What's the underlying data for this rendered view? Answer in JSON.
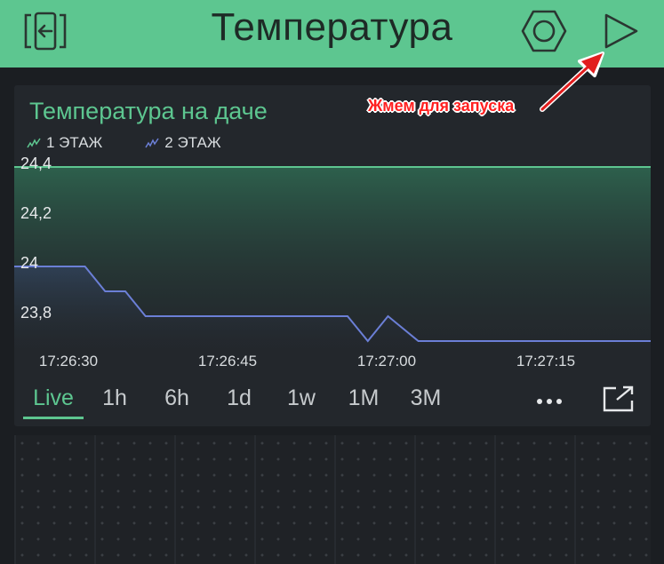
{
  "header": {
    "title": "Температура",
    "back_icon": "exit-app-icon",
    "settings_icon": "hexagon-settings-icon",
    "play_icon": "play-icon",
    "color": "#5dc690"
  },
  "card": {
    "title": "Температура на даче",
    "legend": [
      {
        "label": "1 ЭТАЖ",
        "color": "#5dc690"
      },
      {
        "label": "2 ЭТАЖ",
        "color": "#6b7fd6"
      }
    ],
    "time_ranges": [
      {
        "label": "Live",
        "active": true
      },
      {
        "label": "1h",
        "active": false
      },
      {
        "label": "6h",
        "active": false
      },
      {
        "label": "1d",
        "active": false
      },
      {
        "label": "1w",
        "active": false
      },
      {
        "label": "1M",
        "active": false
      },
      {
        "label": "3M",
        "active": false
      }
    ],
    "more_icon": "more-horizontal-icon",
    "expand_icon": "open-fullscreen-icon"
  },
  "annotation": {
    "text": "Жмем для запуска",
    "color": "#ff2020"
  },
  "chart_data": {
    "type": "line",
    "title": "Температура на даче",
    "y_tick_labels": [
      "24,4",
      "24,2",
      "24",
      "23,8"
    ],
    "x_tick_labels": [
      "17:26:30",
      "17:26:45",
      "17:27:00",
      "17:27:15"
    ],
    "ylim": [
      23.62,
      24.46
    ],
    "xlim": [
      "17:26:27",
      "17:27:30"
    ],
    "series": [
      {
        "name": "1 ЭТАЖ",
        "color": "#5dc690",
        "fill": true,
        "x": [
          "17:26:27",
          "17:27:30"
        ],
        "y": [
          24.4,
          24.4
        ]
      },
      {
        "name": "2 ЭТАЖ",
        "color": "#6b7fd6",
        "fill": true,
        "x": [
          "17:26:27",
          "17:26:34",
          "17:26:36",
          "17:26:38",
          "17:26:40",
          "17:27:00",
          "17:27:02",
          "17:27:04",
          "17:27:07",
          "17:27:30"
        ],
        "y": [
          24.0,
          24.0,
          23.9,
          23.9,
          23.8,
          23.8,
          23.7,
          23.8,
          23.7,
          23.7
        ]
      }
    ],
    "grid": false
  }
}
